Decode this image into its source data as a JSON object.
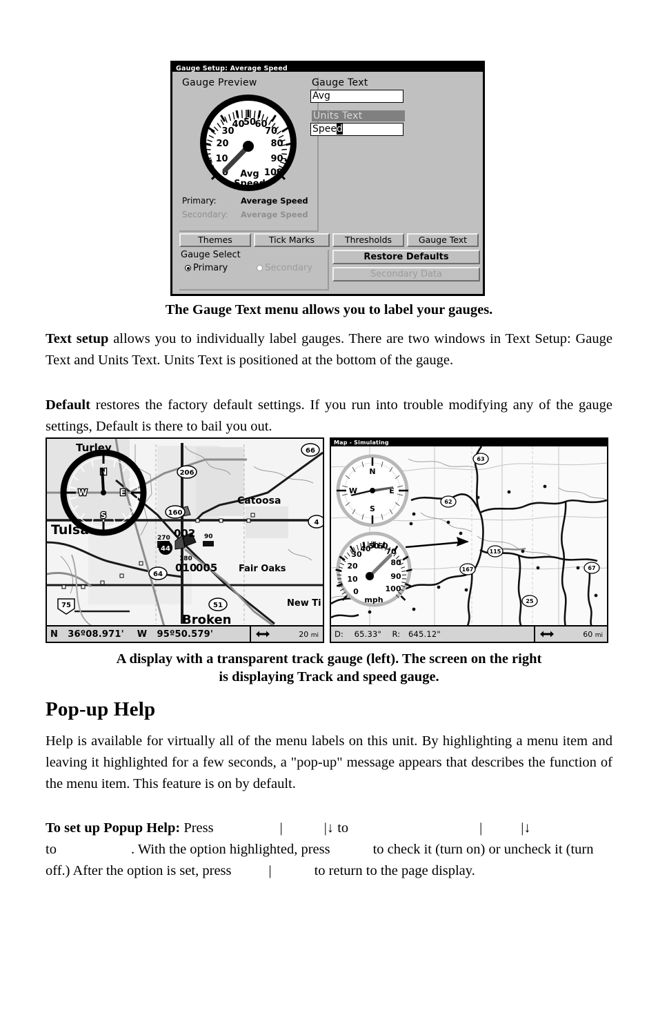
{
  "figure1": {
    "name": "gauge-setup-dialog",
    "title": "Gauge Setup: Average Speed",
    "preview_label": "Gauge Preview",
    "gauge": {
      "tick_labels": [
        "0",
        "10",
        "20",
        "30",
        "40",
        "50",
        "60",
        "70",
        "80",
        "90",
        "100"
      ],
      "center_label_line1": "Avg",
      "center_label_line2": "Speed",
      "needle_value": 8,
      "min": 0,
      "max": 100
    },
    "primary_label": "Primary:",
    "primary_value": "Average Speed",
    "secondary_label": "Secondary:",
    "secondary_value": "Average Speed",
    "gauge_text_label": "Gauge Text",
    "gauge_text_value": "Avg",
    "units_text_label": "Units Text",
    "units_text_value": "Spee",
    "units_text_caret_char": "d",
    "buttons": [
      "Themes",
      "Tick Marks",
      "Thresholds",
      "Gauge Text"
    ],
    "gauge_select_label": "Gauge Select",
    "radio_primary": "Primary",
    "radio_secondary": "Secondary",
    "restore_defaults": "Restore Defaults",
    "secondary_data": "Secondary Data"
  },
  "caption1": "The Gauge Text menu allows you to label your gauges.",
  "paragraphs": {
    "text_setup_lead": "Text setup",
    "text_setup_body": " allows you to individually label gauges. There are two windows in Text Setup: Gauge Text and Units Text. Units Text is positioned at the bottom of the gauge.",
    "default_lead": "Default",
    "default_body": " restores the factory default settings. If you run into trouble modifying any of the gauge settings, Default is there to bail you out."
  },
  "figure2": {
    "left_screen": {
      "name": "map-with-transparent-track-gauge",
      "latitude": "36º08.971'",
      "longitude": "95º50.579'",
      "lat_hemi": "N",
      "lon_hemi": "W",
      "zoom": "20",
      "zoom_unit": "mi",
      "compass": {
        "n": "N",
        "e": "E",
        "s": "S",
        "w": "W"
      },
      "place_labels": [
        "Turley",
        "Tulsa",
        "Catoosa",
        "Fair Oaks",
        "New Ti",
        "Broken"
      ],
      "highway_shields": [
        "66",
        "206",
        "4",
        "64",
        "75",
        "51"
      ],
      "waypoints": [
        "010",
        "005",
        "002"
      ],
      "bearing_labels": [
        "270",
        "90",
        "180",
        "44"
      ]
    },
    "right_screen": {
      "name": "map-with-track-and-speed-gauge",
      "title": "Map - Simulating",
      "distance_label": "D:",
      "distance_value": "65.33\"",
      "bearing_label": "R:",
      "bearing_value": "645.12\"",
      "zoom": "60",
      "zoom_unit": "mi",
      "compass": {
        "n": "N",
        "e": "E",
        "s": "S",
        "w": "W"
      },
      "speed_gauge": {
        "tick_labels": [
          "0",
          "10",
          "20",
          "30",
          "40",
          "50",
          "60",
          "70",
          "80",
          "90",
          "100"
        ],
        "unit_label": "mph",
        "needle_value": 72
      },
      "highway_shields": [
        "63",
        "62",
        "115",
        "167",
        "25",
        "67"
      ]
    }
  },
  "caption2_line1": "A display with a transparent track gauge (left). The screen on the right",
  "caption2_line2": "is displaying Track and speed gauge.",
  "section_heading": "Pop-up Help",
  "popup_help_para": "Help is available for virtually all of the menu labels on this unit. By highlighting a menu item and leaving it highlighted for a few seconds, a \"pop-up\" message appears that describes the function of the menu item. This feature is on by default.",
  "setup_popup": {
    "lead": "To set up Popup Help:",
    "s1": " Press",
    "sep_bar": "|",
    "sep_bardown": "|↓",
    "s2": " to",
    "s3": "to",
    "s4": ". With the option highlighted, press",
    "s5": "to check it (turn on) or uncheck it (turn off.) After the option is set, press",
    "s6": "to return to the page display."
  }
}
